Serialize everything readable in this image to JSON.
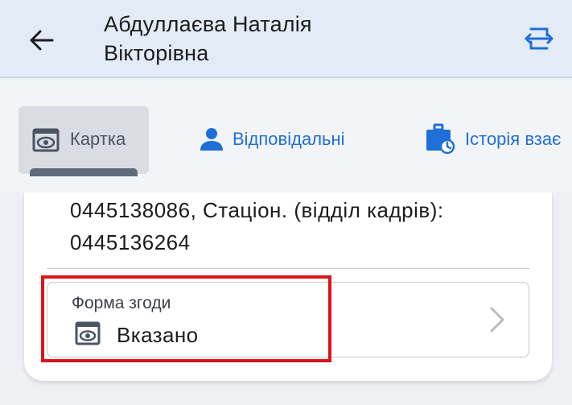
{
  "header": {
    "title_line1": "Абдуллаєва Наталія",
    "title_line2": "Вікторівна",
    "back_icon": "arrow-left-icon",
    "action_icon": "transfer-icon"
  },
  "tabs": [
    {
      "label": "Картка",
      "icon": "eye-icon",
      "selected": true
    },
    {
      "label": "Відповідальні",
      "icon": "person-icon",
      "selected": false
    },
    {
      "label": "Історія взає",
      "icon": "briefcase-clock-icon",
      "selected": false
    }
  ],
  "card": {
    "phones_line1": "0445138086, Стаціон. (відділ кадрів):",
    "phones_line2": "0445136264",
    "consent": {
      "label": "Форма згоди",
      "value": "Вказано",
      "icon": "eye-icon"
    }
  },
  "colors": {
    "accent": "#1e6fd6",
    "header_bg": "#e3ebf6",
    "highlight": "#d8161b"
  }
}
